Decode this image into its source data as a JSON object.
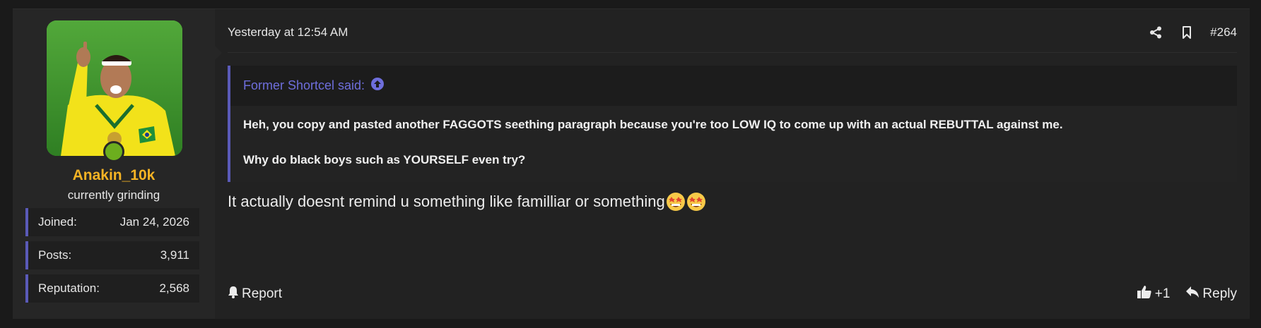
{
  "user": {
    "username": "Anakin_10k",
    "title": "currently grinding",
    "stats": [
      {
        "label": "Joined:",
        "value": "Jan 24, 2026"
      },
      {
        "label": "Posts:",
        "value": "3,911"
      },
      {
        "label": "Reputation:",
        "value": "2,568"
      }
    ]
  },
  "post": {
    "date": "Yesterday at 12:54 AM",
    "number": "#264",
    "quote": {
      "author": "Former Shortcel said:",
      "line1": "Heh, you copy and pasted another FAGGOTS seething paragraph because you're too LOW IQ to come up with an actual REBUTTAL against me.",
      "line2": "Why do black boys such as YOURSELF even try?"
    },
    "message": "It actually doesnt remind u something like familliar or something",
    "emojis": [
      "grinning-star-eyes-emoji",
      "grinning-star-eyes-emoji"
    ]
  },
  "footer": {
    "report_label": "Report",
    "like_label": "+1",
    "reply_label": "Reply"
  },
  "colors": {
    "accent": "#5a5ab8",
    "username": "#f5b324",
    "online": "#6cae1e",
    "quote_author": "#6e6edc"
  }
}
